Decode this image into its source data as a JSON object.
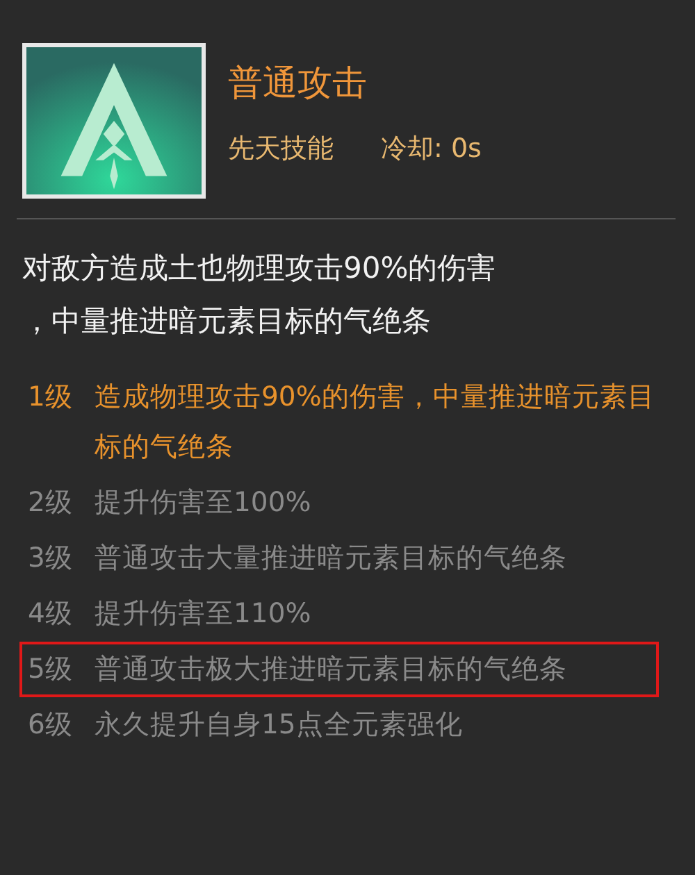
{
  "skill": {
    "name": "普通攻击",
    "type": "先天技能",
    "cooldown": "冷却: 0s"
  },
  "description_lines": [
    "对敌方造成土也物理攻击90%的伤害",
    "，中量推进暗元素目标的气绝条"
  ],
  "levels": [
    {
      "level": "1级",
      "text": "造成物理攻击90%的伤害，中量推进暗元素目标的气绝条",
      "active": true,
      "highlighted": false
    },
    {
      "level": "2级",
      "text": "提升伤害至100%",
      "active": false,
      "highlighted": false
    },
    {
      "level": "3级",
      "text": "普通攻击大量推进暗元素目标的气绝条",
      "active": false,
      "highlighted": false
    },
    {
      "level": "4级",
      "text": "提升伤害至110%",
      "active": false,
      "highlighted": false
    },
    {
      "level": "5级",
      "text": "普通攻击极大推进暗元素目标的气绝条",
      "active": false,
      "highlighted": true
    },
    {
      "level": "6级",
      "text": "永久提升自身15点全元素强化",
      "active": false,
      "highlighted": false
    }
  ]
}
